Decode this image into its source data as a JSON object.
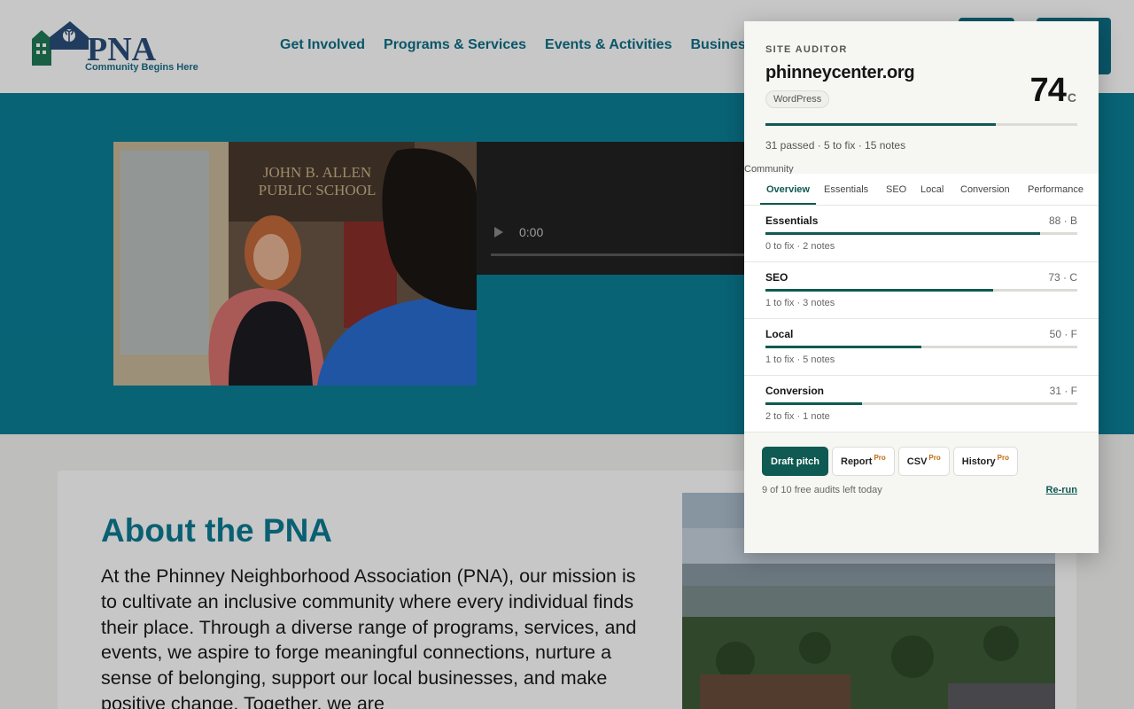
{
  "site": {
    "logo_text": "PNA",
    "logo_tagline": "Community Begins Here",
    "nav": [
      "Get Involved",
      "Programs & Services",
      "Events & Activities",
      "Business"
    ],
    "hero_photo_sign": "JOHN B. ALLEN PUBLIC SCHOOL",
    "video_time": "0:00",
    "about_title": "About the PNA",
    "about_body": "At the Phinney Neighborhood Association (PNA), our mission is to cultivate an inclusive community where every individual finds their place. Through a diverse range of programs, services, and events, we aspire to forge meaningful connections, nurture a sense of belonging, support our local businesses, and make positive change. Together, we are"
  },
  "auditor": {
    "kicker": "SITE AUDITOR",
    "domain": "phinneycenter.org",
    "platform": "WordPress",
    "score": "74",
    "grade": "C",
    "score_value": 74,
    "summary": "31 passed · 5 to fix · 15 notes",
    "community_label": "Community",
    "tabs": [
      "Overview",
      "Essentials",
      "SEO",
      "Local",
      "Conversion",
      "Performance"
    ],
    "active_tab": "Overview",
    "categories": [
      {
        "name": "Essentials",
        "score": "88 · B",
        "value": 88,
        "meta": "0 to fix · 2 notes"
      },
      {
        "name": "SEO",
        "score": "73 · C",
        "value": 73,
        "meta": "1 to fix · 3 notes"
      },
      {
        "name": "Local",
        "score": "50 · F",
        "value": 50,
        "meta": "1 to fix · 5 notes"
      },
      {
        "name": "Conversion",
        "score": "31 · F",
        "value": 31,
        "meta": "2 to fix · 1 note"
      }
    ],
    "actions": {
      "draft_pitch": "Draft pitch",
      "report": "Report",
      "csv": "CSV",
      "history": "History",
      "pro_badge": "Pro"
    },
    "quota": "9 of 10 free audits left today",
    "rerun": "Re-run",
    "accent_color": "#0f5a52"
  }
}
